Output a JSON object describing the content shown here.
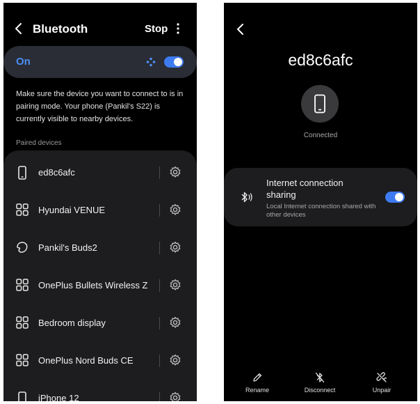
{
  "bluetooth_screen": {
    "title": "Bluetooth",
    "stop_label": "Stop",
    "on_label": "On",
    "info_text": "Make sure the device you want to connect to is in pairing mode. Your phone (Pankil's S22) is currently visible to nearby devices.",
    "paired_label": "Paired devices",
    "devices": [
      {
        "name": "ed8c6afc",
        "icon": "phone-icon"
      },
      {
        "name": "Hyundai VENUE",
        "icon": "grid-icon"
      },
      {
        "name": "Pankil's Buds2",
        "icon": "earbuds-icon"
      },
      {
        "name": "OnePlus Bullets Wireless Z",
        "icon": "grid-icon"
      },
      {
        "name": "Bedroom display",
        "icon": "grid-icon"
      },
      {
        "name": "OnePlus Nord Buds CE",
        "icon": "grid-icon"
      },
      {
        "name": "iPhone 12",
        "icon": "phone-icon"
      }
    ],
    "accent_color": "#4c8ff5"
  },
  "device_screen": {
    "title": "ed8c6afc",
    "status": "Connected",
    "sharing_title": "Internet connection sharing",
    "sharing_desc": "Local Internet connection shared with other devices",
    "actions": [
      {
        "label": "Rename",
        "icon": "pencil-icon"
      },
      {
        "label": "Disconnect",
        "icon": "bluetooth-off-icon"
      },
      {
        "label": "Unpair",
        "icon": "unlink-icon"
      }
    ]
  }
}
